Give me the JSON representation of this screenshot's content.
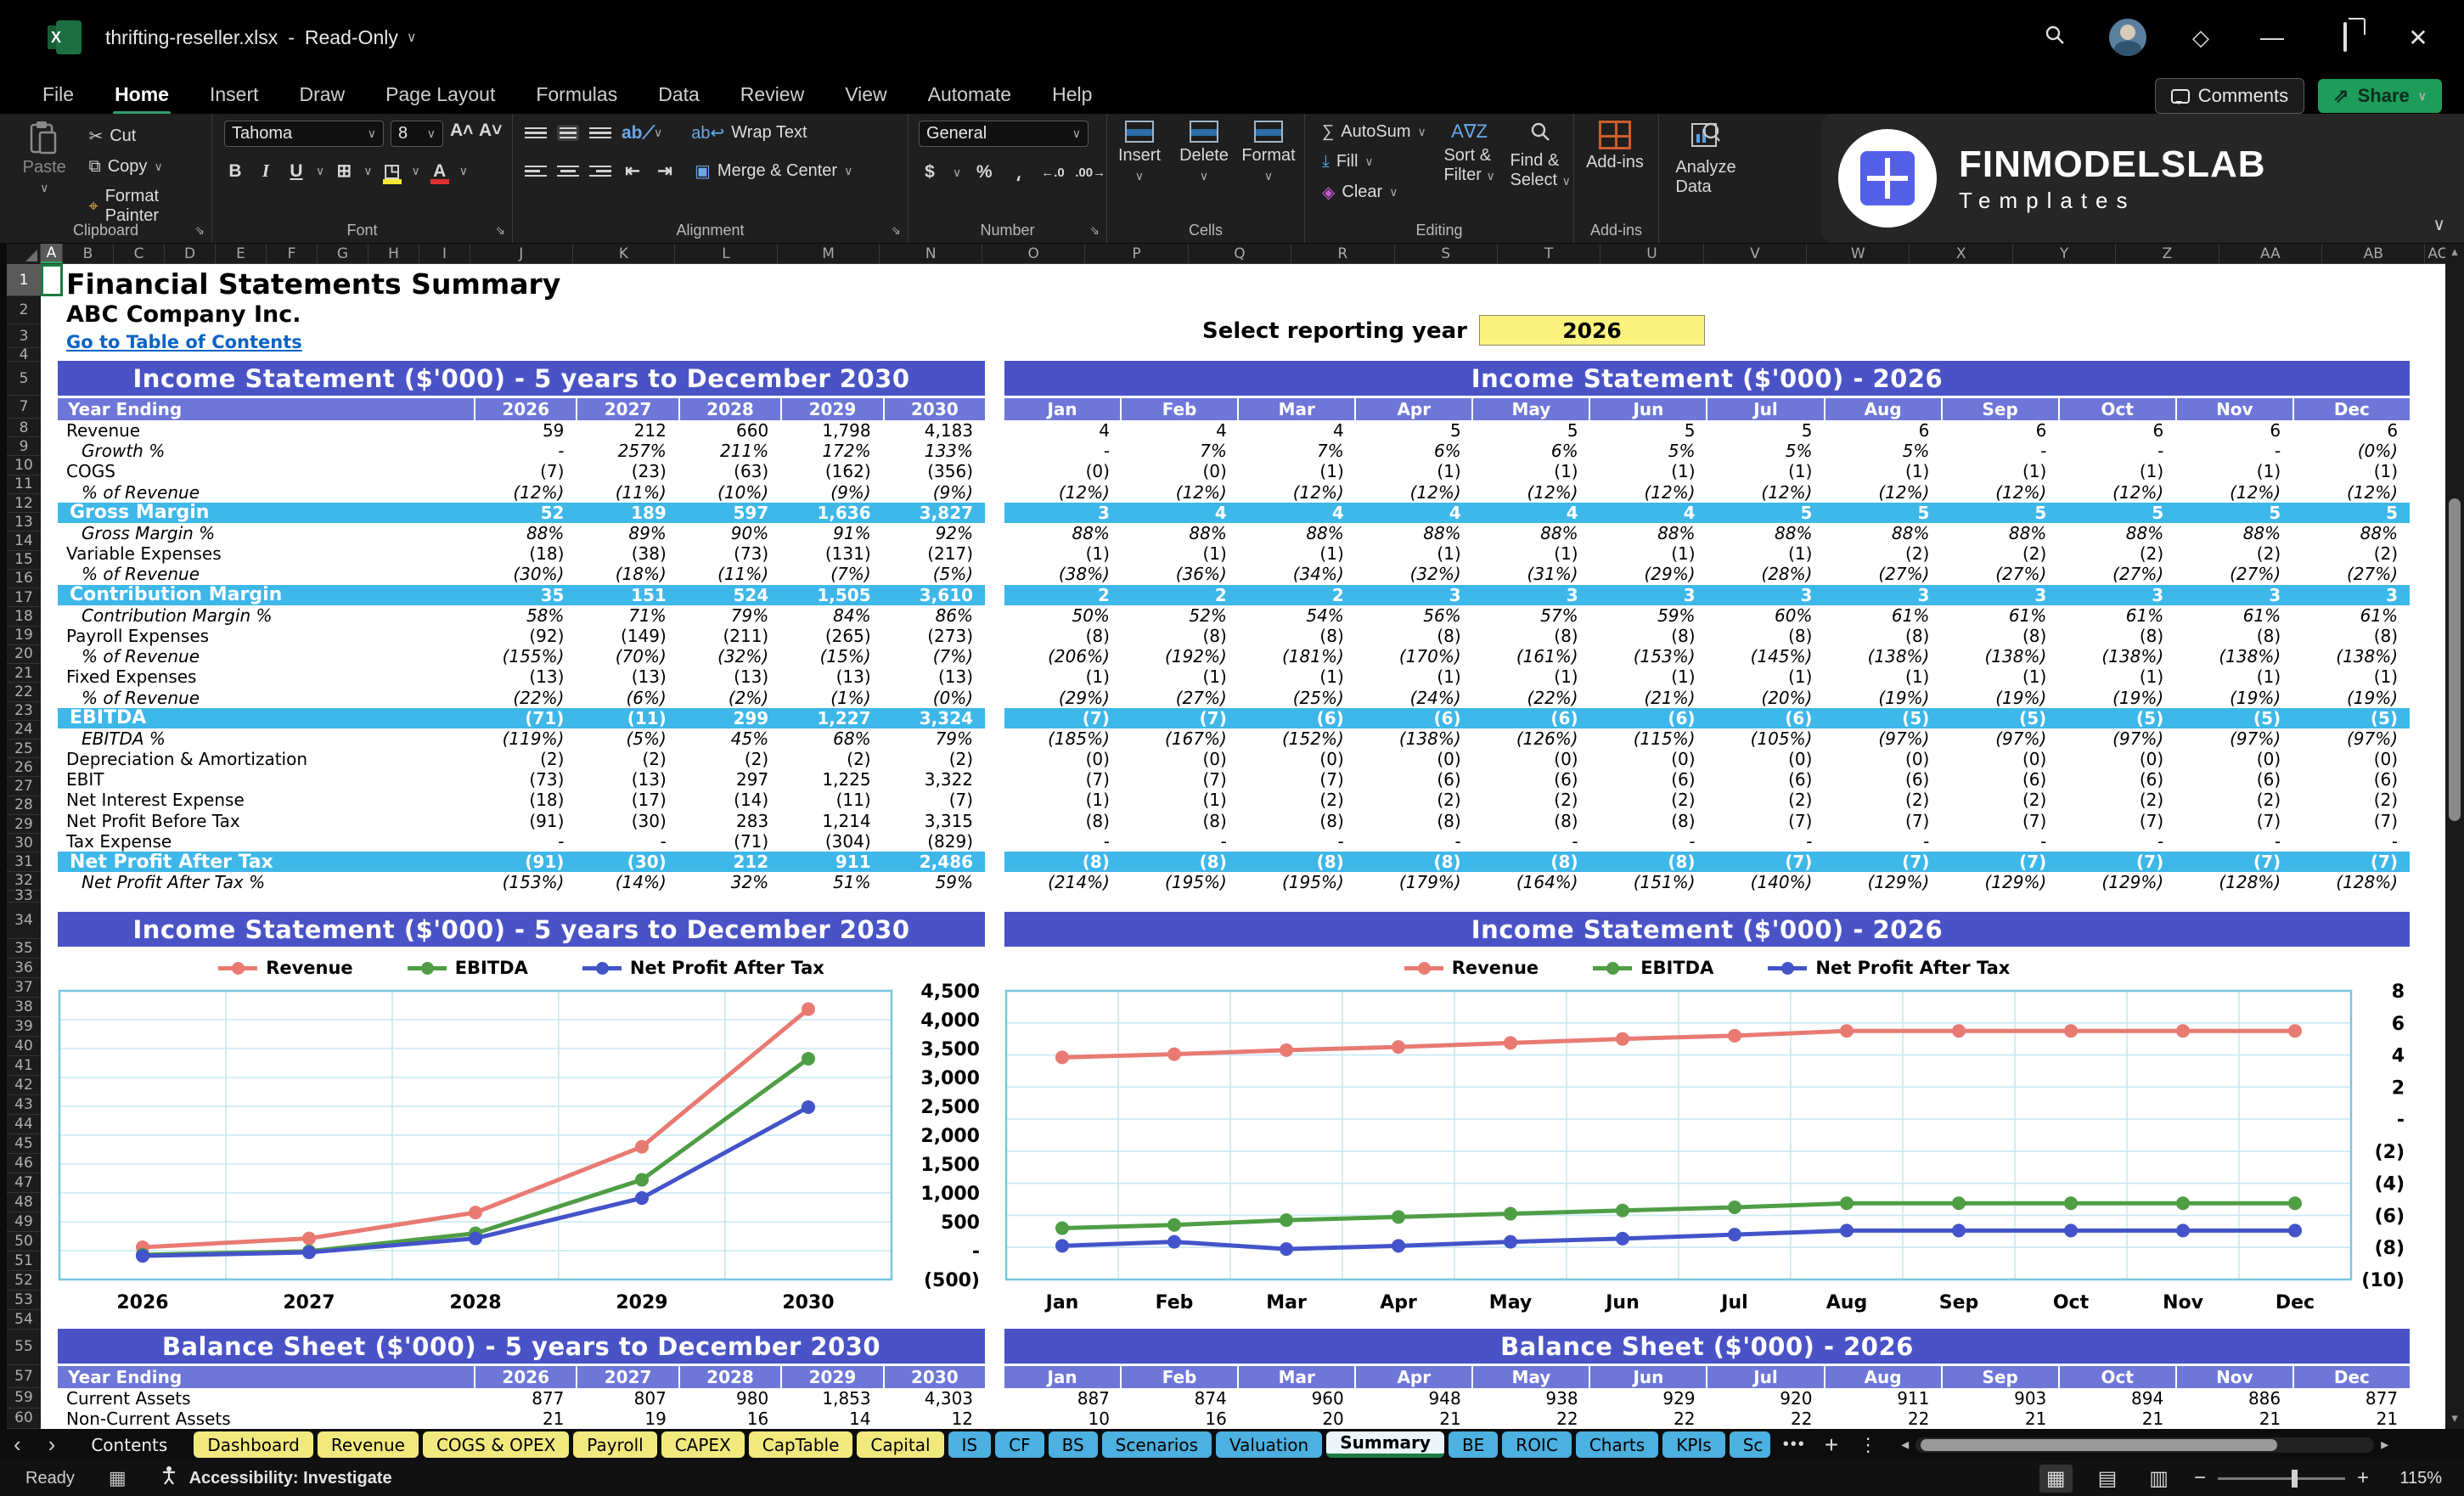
{
  "titlebar": {
    "filename": "thrifting-reseller.xlsx",
    "separator": "-",
    "mode": "Read-Only"
  },
  "menubar": {
    "items": [
      "File",
      "Home",
      "Insert",
      "Draw",
      "Page Layout",
      "Formulas",
      "Data",
      "Review",
      "View",
      "Automate",
      "Help"
    ],
    "active": "Home",
    "comments": "Comments",
    "share": "Share"
  },
  "ribbon": {
    "paste": "Paste",
    "cut": "Cut",
    "copy": "Copy",
    "format_painter": "Format Painter",
    "clipboard": "Clipboard",
    "font_name": "Tahoma",
    "font_size": "8",
    "font": "Font",
    "wrap_text": "Wrap Text",
    "merge_center": "Merge & Center",
    "alignment": "Alignment",
    "number_format": "General",
    "number": "Number",
    "insert": "Insert",
    "delete": "Delete",
    "format": "Format",
    "cells": "Cells",
    "autosum": "AutoSum",
    "fill": "Fill",
    "clear": "Clear",
    "sort_filter_1": "Sort &",
    "sort_filter_2": "Filter",
    "find_select_1": "Find &",
    "find_select_2": "Select",
    "editing": "Editing",
    "addins": "Add-ins",
    "analyze_1": "Analyze",
    "analyze_2": "Data"
  },
  "logo": {
    "line1": "FINMODELSLAB",
    "line2": "Templates"
  },
  "page": {
    "title": "Financial Statements Summary",
    "company": "ABC Company Inc.",
    "link": "Go to Table of Contents",
    "year_label": "Select reporting year",
    "year_value": "2026"
  },
  "annual_is": {
    "title": "Income Statement ($'000) - 5 years to December 2030",
    "header_label": "Year Ending",
    "columns": [
      "2026",
      "2027",
      "2028",
      "2029",
      "2030"
    ],
    "rows": [
      {
        "label": "Revenue",
        "style": "n",
        "values": [
          "59",
          "212",
          "660",
          "1,798",
          "4,183"
        ]
      },
      {
        "label": "Growth %",
        "style": "i",
        "values": [
          "-",
          "257%",
          "211%",
          "172%",
          "133%"
        ]
      },
      {
        "label": "COGS",
        "style": "n",
        "values": [
          "(7)",
          "(23)",
          "(63)",
          "(162)",
          "(356)"
        ]
      },
      {
        "label": "% of Revenue",
        "style": "i",
        "values": [
          "(12%)",
          "(11%)",
          "(10%)",
          "(9%)",
          "(9%)"
        ]
      },
      {
        "label": "Gross Margin",
        "style": "h",
        "values": [
          "52",
          "189",
          "597",
          "1,636",
          "3,827"
        ]
      },
      {
        "label": "Gross Margin %",
        "style": "i",
        "values": [
          "88%",
          "89%",
          "90%",
          "91%",
          "92%"
        ]
      },
      {
        "label": "Variable Expenses",
        "style": "n",
        "values": [
          "(18)",
          "(38)",
          "(73)",
          "(131)",
          "(217)"
        ]
      },
      {
        "label": "% of Revenue",
        "style": "i",
        "values": [
          "(30%)",
          "(18%)",
          "(11%)",
          "(7%)",
          "(5%)"
        ]
      },
      {
        "label": "Contribution Margin",
        "style": "h",
        "values": [
          "35",
          "151",
          "524",
          "1,505",
          "3,610"
        ]
      },
      {
        "label": "Contribution Margin %",
        "style": "i",
        "values": [
          "58%",
          "71%",
          "79%",
          "84%",
          "86%"
        ]
      },
      {
        "label": "Payroll Expenses",
        "style": "n",
        "values": [
          "(92)",
          "(149)",
          "(211)",
          "(265)",
          "(273)"
        ]
      },
      {
        "label": "% of Revenue",
        "style": "i",
        "values": [
          "(155%)",
          "(70%)",
          "(32%)",
          "(15%)",
          "(7%)"
        ]
      },
      {
        "label": "Fixed Expenses",
        "style": "n",
        "values": [
          "(13)",
          "(13)",
          "(13)",
          "(13)",
          "(13)"
        ]
      },
      {
        "label": "% of Revenue",
        "style": "i",
        "values": [
          "(22%)",
          "(6%)",
          "(2%)",
          "(1%)",
          "(0%)"
        ]
      },
      {
        "label": "EBITDA",
        "style": "h",
        "values": [
          "(71)",
          "(11)",
          "299",
          "1,227",
          "3,324"
        ]
      },
      {
        "label": "EBITDA %",
        "style": "i",
        "values": [
          "(119%)",
          "(5%)",
          "45%",
          "68%",
          "79%"
        ]
      },
      {
        "label": "Depreciation & Amortization",
        "style": "n",
        "values": [
          "(2)",
          "(2)",
          "(2)",
          "(2)",
          "(2)"
        ]
      },
      {
        "label": "EBIT",
        "style": "n",
        "values": [
          "(73)",
          "(13)",
          "297",
          "1,225",
          "3,322"
        ]
      },
      {
        "label": "Net Interest Expense",
        "style": "n",
        "values": [
          "(18)",
          "(17)",
          "(14)",
          "(11)",
          "(7)"
        ]
      },
      {
        "label": "Net Profit Before Tax",
        "style": "n",
        "values": [
          "(91)",
          "(30)",
          "283",
          "1,214",
          "3,315"
        ]
      },
      {
        "label": "Tax Expense",
        "style": "n",
        "values": [
          "-",
          "-",
          "(71)",
          "(304)",
          "(829)"
        ]
      },
      {
        "label": "Net Profit After Tax",
        "style": "h",
        "values": [
          "(91)",
          "(30)",
          "212",
          "911",
          "2,486"
        ]
      },
      {
        "label": "Net Profit After Tax %",
        "style": "i",
        "values": [
          "(153%)",
          "(14%)",
          "32%",
          "51%",
          "59%"
        ]
      }
    ]
  },
  "monthly_is": {
    "title": "Income Statement ($'000) - 2026",
    "columns": [
      "Jan",
      "Feb",
      "Mar",
      "Apr",
      "May",
      "Jun",
      "Jul",
      "Aug",
      "Sep",
      "Oct",
      "Nov",
      "Dec"
    ],
    "rows": [
      {
        "style": "n",
        "values": [
          "4",
          "4",
          "4",
          "5",
          "5",
          "5",
          "5",
          "6",
          "6",
          "6",
          "6",
          "6"
        ]
      },
      {
        "style": "i",
        "values": [
          "-",
          "7%",
          "7%",
          "6%",
          "6%",
          "5%",
          "5%",
          "5%",
          "-",
          "-",
          "-",
          "(0%)"
        ]
      },
      {
        "style": "n",
        "values": [
          "(0)",
          "(0)",
          "(1)",
          "(1)",
          "(1)",
          "(1)",
          "(1)",
          "(1)",
          "(1)",
          "(1)",
          "(1)",
          "(1)"
        ]
      },
      {
        "style": "i",
        "values": [
          "(12%)",
          "(12%)",
          "(12%)",
          "(12%)",
          "(12%)",
          "(12%)",
          "(12%)",
          "(12%)",
          "(12%)",
          "(12%)",
          "(12%)",
          "(12%)"
        ]
      },
      {
        "style": "h",
        "values": [
          "3",
          "4",
          "4",
          "4",
          "4",
          "4",
          "5",
          "5",
          "5",
          "5",
          "5",
          "5"
        ]
      },
      {
        "style": "i",
        "values": [
          "88%",
          "88%",
          "88%",
          "88%",
          "88%",
          "88%",
          "88%",
          "88%",
          "88%",
          "88%",
          "88%",
          "88%"
        ]
      },
      {
        "style": "n",
        "values": [
          "(1)",
          "(1)",
          "(1)",
          "(1)",
          "(1)",
          "(1)",
          "(1)",
          "(2)",
          "(2)",
          "(2)",
          "(2)",
          "(2)"
        ]
      },
      {
        "style": "i",
        "values": [
          "(38%)",
          "(36%)",
          "(34%)",
          "(32%)",
          "(31%)",
          "(29%)",
          "(28%)",
          "(27%)",
          "(27%)",
          "(27%)",
          "(27%)",
          "(27%)"
        ]
      },
      {
        "style": "h",
        "values": [
          "2",
          "2",
          "2",
          "3",
          "3",
          "3",
          "3",
          "3",
          "3",
          "3",
          "3",
          "3"
        ]
      },
      {
        "style": "i",
        "values": [
          "50%",
          "52%",
          "54%",
          "56%",
          "57%",
          "59%",
          "60%",
          "61%",
          "61%",
          "61%",
          "61%",
          "61%"
        ]
      },
      {
        "style": "n",
        "values": [
          "(8)",
          "(8)",
          "(8)",
          "(8)",
          "(8)",
          "(8)",
          "(8)",
          "(8)",
          "(8)",
          "(8)",
          "(8)",
          "(8)"
        ]
      },
      {
        "style": "i",
        "values": [
          "(206%)",
          "(192%)",
          "(181%)",
          "(170%)",
          "(161%)",
          "(153%)",
          "(145%)",
          "(138%)",
          "(138%)",
          "(138%)",
          "(138%)",
          "(138%)"
        ]
      },
      {
        "style": "n",
        "values": [
          "(1)",
          "(1)",
          "(1)",
          "(1)",
          "(1)",
          "(1)",
          "(1)",
          "(1)",
          "(1)",
          "(1)",
          "(1)",
          "(1)"
        ]
      },
      {
        "style": "i",
        "values": [
          "(29%)",
          "(27%)",
          "(25%)",
          "(24%)",
          "(22%)",
          "(21%)",
          "(20%)",
          "(19%)",
          "(19%)",
          "(19%)",
          "(19%)",
          "(19%)"
        ]
      },
      {
        "style": "h",
        "values": [
          "(7)",
          "(7)",
          "(6)",
          "(6)",
          "(6)",
          "(6)",
          "(6)",
          "(5)",
          "(5)",
          "(5)",
          "(5)",
          "(5)"
        ]
      },
      {
        "style": "i",
        "values": [
          "(185%)",
          "(167%)",
          "(152%)",
          "(138%)",
          "(126%)",
          "(115%)",
          "(105%)",
          "(97%)",
          "(97%)",
          "(97%)",
          "(97%)",
          "(97%)"
        ]
      },
      {
        "style": "n",
        "values": [
          "(0)",
          "(0)",
          "(0)",
          "(0)",
          "(0)",
          "(0)",
          "(0)",
          "(0)",
          "(0)",
          "(0)",
          "(0)",
          "(0)"
        ]
      },
      {
        "style": "n",
        "values": [
          "(7)",
          "(7)",
          "(7)",
          "(6)",
          "(6)",
          "(6)",
          "(6)",
          "(6)",
          "(6)",
          "(6)",
          "(6)",
          "(6)"
        ]
      },
      {
        "style": "n",
        "values": [
          "(1)",
          "(1)",
          "(2)",
          "(2)",
          "(2)",
          "(2)",
          "(2)",
          "(2)",
          "(2)",
          "(2)",
          "(2)",
          "(2)"
        ]
      },
      {
        "style": "n",
        "values": [
          "(8)",
          "(8)",
          "(8)",
          "(8)",
          "(8)",
          "(8)",
          "(7)",
          "(7)",
          "(7)",
          "(7)",
          "(7)",
          "(7)"
        ]
      },
      {
        "style": "n",
        "values": [
          "-",
          "-",
          "-",
          "-",
          "-",
          "-",
          "-",
          "-",
          "-",
          "-",
          "-",
          "-"
        ]
      },
      {
        "style": "h",
        "values": [
          "(8)",
          "(8)",
          "(8)",
          "(8)",
          "(8)",
          "(8)",
          "(7)",
          "(7)",
          "(7)",
          "(7)",
          "(7)",
          "(7)"
        ]
      },
      {
        "style": "i",
        "values": [
          "(214%)",
          "(195%)",
          "(195%)",
          "(179%)",
          "(164%)",
          "(151%)",
          "(140%)",
          "(129%)",
          "(129%)",
          "(129%)",
          "(128%)",
          "(128%)"
        ]
      }
    ]
  },
  "annual_bs": {
    "title": "Balance Sheet ($'000) - 5 years to December 2030",
    "header_label": "Year Ending",
    "columns": [
      "2026",
      "2027",
      "2028",
      "2029",
      "2030"
    ],
    "rows": [
      {
        "label": "Current Assets",
        "style": "n",
        "values": [
          "877",
          "807",
          "980",
          "1,853",
          "4,303"
        ]
      },
      {
        "label": "Non-Current Assets",
        "style": "n",
        "values": [
          "21",
          "19",
          "16",
          "14",
          "12"
        ]
      }
    ]
  },
  "monthly_bs": {
    "title": "Balance Sheet ($'000) - 2026",
    "columns": [
      "Jan",
      "Feb",
      "Mar",
      "Apr",
      "May",
      "Jun",
      "Jul",
      "Aug",
      "Sep",
      "Oct",
      "Nov",
      "Dec"
    ],
    "rows": [
      {
        "style": "n",
        "values": [
          "887",
          "874",
          "960",
          "948",
          "938",
          "929",
          "920",
          "911",
          "903",
          "894",
          "886",
          "877"
        ]
      },
      {
        "style": "n",
        "values": [
          "10",
          "16",
          "20",
          "21",
          "22",
          "22",
          "22",
          "22",
          "21",
          "21",
          "21",
          "21"
        ]
      }
    ]
  },
  "chart_data": [
    {
      "type": "line",
      "title": "Income Statement ($'000) - 5 years to December 2030",
      "categories": [
        "2026",
        "2027",
        "2028",
        "2029",
        "2030"
      ],
      "series": [
        {
          "name": "Revenue",
          "color": "#e87a72",
          "values": [
            59,
            212,
            660,
            1798,
            4183
          ]
        },
        {
          "name": "EBITDA",
          "color": "#4f9d45",
          "values": [
            -71,
            -11,
            299,
            1227,
            3324
          ]
        },
        {
          "name": "Net Profit After Tax",
          "color": "#4353c9",
          "values": [
            -91,
            -30,
            212,
            911,
            2486
          ]
        }
      ],
      "ylim": [
        -500,
        4500
      ],
      "ystep": 500,
      "ytick_labels": [
        "4,500",
        "4,000",
        "3,500",
        "3,000",
        "2,500",
        "2,000",
        "1,500",
        "1,000",
        "500",
        "-",
        "(500)"
      ],
      "legend_position": "top",
      "grid": true
    },
    {
      "type": "line",
      "title": "Income Statement ($'000) - 2026",
      "categories": [
        "Jan",
        "Feb",
        "Mar",
        "Apr",
        "May",
        "Jun",
        "Jul",
        "Aug",
        "Sep",
        "Oct",
        "Nov",
        "Dec"
      ],
      "series": [
        {
          "name": "Revenue",
          "color": "#e87a72",
          "values": [
            3.85,
            4.05,
            4.3,
            4.5,
            4.75,
            5.0,
            5.2,
            5.5,
            5.5,
            5.5,
            5.5,
            5.5
          ]
        },
        {
          "name": "EBITDA",
          "color": "#4f9d45",
          "values": [
            -6.8,
            -6.6,
            -6.3,
            -6.1,
            -5.9,
            -5.7,
            -5.5,
            -5.25,
            -5.25,
            -5.25,
            -5.25,
            -5.25
          ]
        },
        {
          "name": "Net Profit After Tax",
          "color": "#4353c9",
          "values": [
            -7.9,
            -7.65,
            -8.1,
            -7.9,
            -7.65,
            -7.45,
            -7.2,
            -6.95,
            -6.95,
            -6.95,
            -6.95,
            -6.95
          ]
        }
      ],
      "ylim": [
        -10,
        8
      ],
      "ystep": 2,
      "ytick_labels": [
        "8",
        "6",
        "4",
        "2",
        "-",
        "(2)",
        "(4)",
        "(6)",
        "(8)",
        "(10)"
      ],
      "legend_position": "top",
      "grid": true
    }
  ],
  "tabs": {
    "items": [
      {
        "label": "Contents",
        "color": "dark"
      },
      {
        "label": "Dashboard",
        "color": "yellow"
      },
      {
        "label": "Revenue",
        "color": "yellow"
      },
      {
        "label": "COGS & OPEX",
        "color": "yellow"
      },
      {
        "label": "Payroll",
        "color": "yellow"
      },
      {
        "label": "CAPEX",
        "color": "yellow"
      },
      {
        "label": "CapTable",
        "color": "yellow"
      },
      {
        "label": "Capital",
        "color": "yellow"
      },
      {
        "label": "IS",
        "color": "blue"
      },
      {
        "label": "CF",
        "color": "blue"
      },
      {
        "label": "BS",
        "color": "blue"
      },
      {
        "label": "Scenarios",
        "color": "blue"
      },
      {
        "label": "Valuation",
        "color": "blue"
      },
      {
        "label": "Summary",
        "color": "active"
      },
      {
        "label": "BE",
        "color": "blue"
      },
      {
        "label": "ROIC",
        "color": "blue"
      },
      {
        "label": "Charts",
        "color": "blue"
      },
      {
        "label": "KPIs",
        "color": "blue"
      },
      {
        "label": "Sc",
        "color": "blue clip"
      }
    ],
    "more": "•••"
  },
  "statusbar": {
    "ready": "Ready",
    "accessibility": "Accessibility: Investigate",
    "zoom": "115%"
  }
}
